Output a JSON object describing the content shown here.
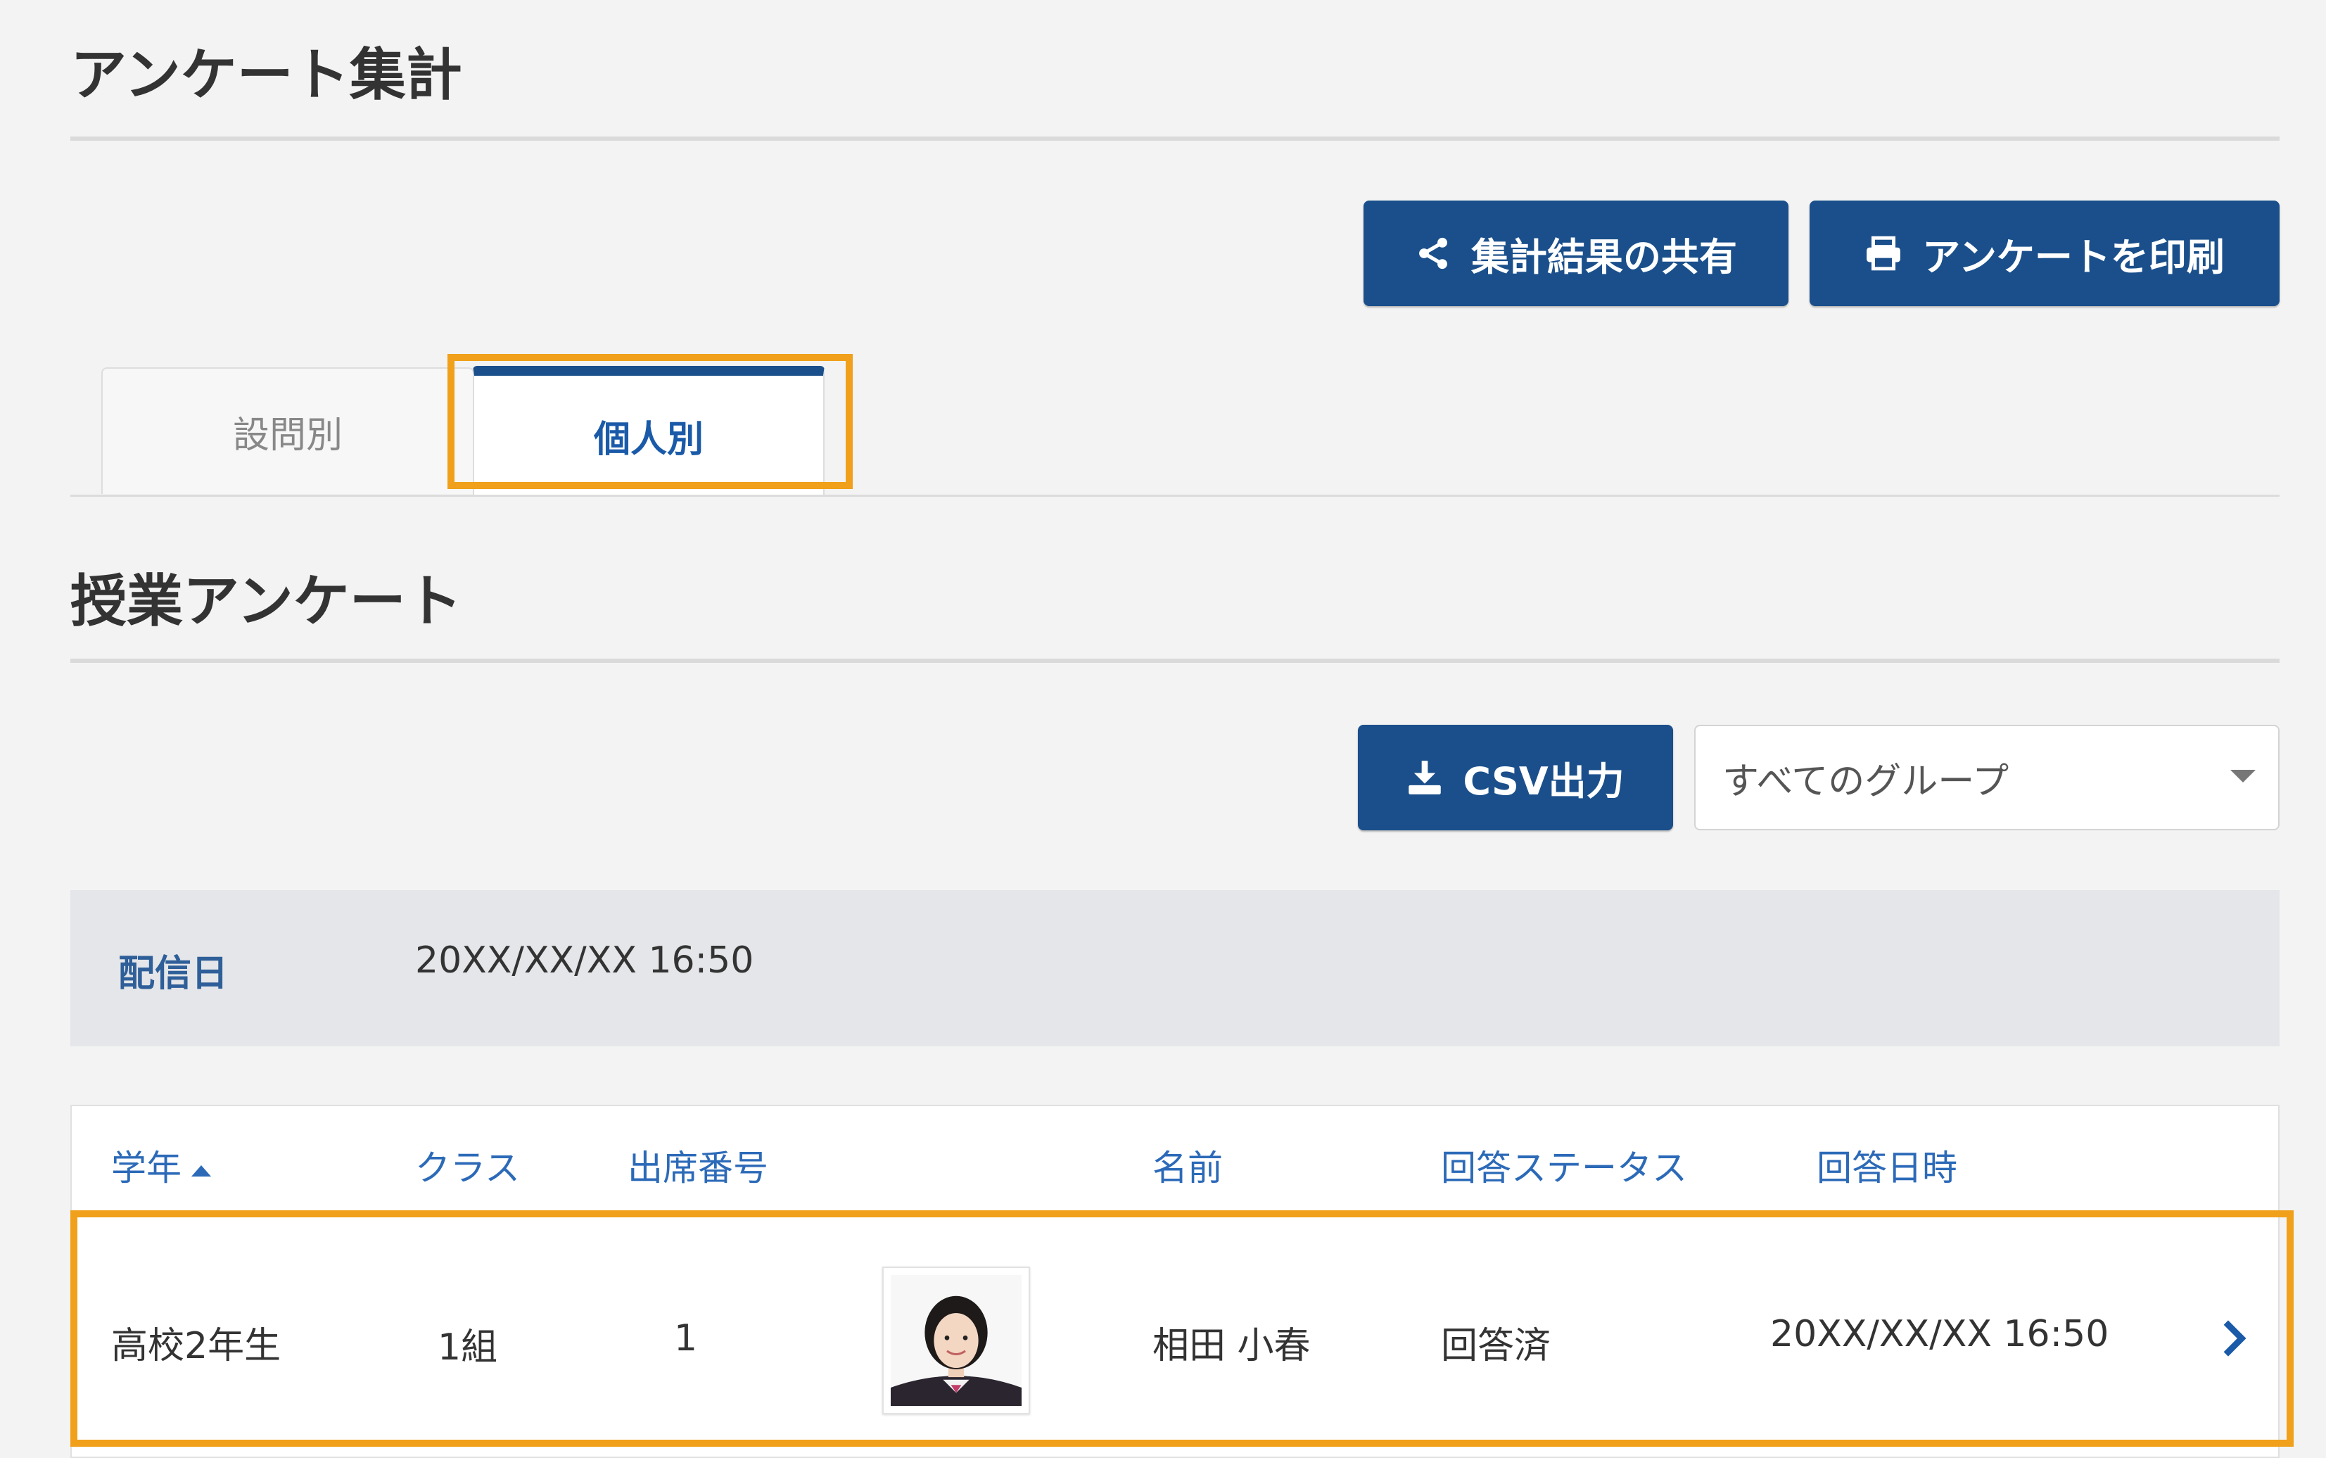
{
  "page": {
    "title": "アンケート集計"
  },
  "toolbar": {
    "share_label": "集計結果の共有",
    "print_label": "アンケートを印刷"
  },
  "tabs": [
    {
      "label": "設問別",
      "active": false
    },
    {
      "label": "個人別",
      "active": true
    }
  ],
  "survey": {
    "title": "授業アンケート",
    "csv_label": "CSV出力",
    "group_select": {
      "selected": "すべてのグループ"
    },
    "delivery": {
      "label": "配信日",
      "value": "20XX/XX/XX 16:50"
    }
  },
  "table": {
    "headers": {
      "grade": "学年",
      "class": "クラス",
      "number": "出席番号",
      "name": "名前",
      "status": "回答ステータス",
      "answered_at": "回答日時"
    },
    "sort": {
      "column": "grade",
      "direction": "asc"
    },
    "rows": [
      {
        "grade": "高校2年生",
        "class": "1組",
        "number": "1",
        "name": "相田 小春",
        "status": "回答済",
        "answered_at": "20XX/XX/XX 16:50"
      }
    ]
  },
  "colors": {
    "primary": "#1a4f8b",
    "link": "#2c6ab8",
    "highlight": "#f0a01a",
    "background": "#f3f3f3"
  }
}
